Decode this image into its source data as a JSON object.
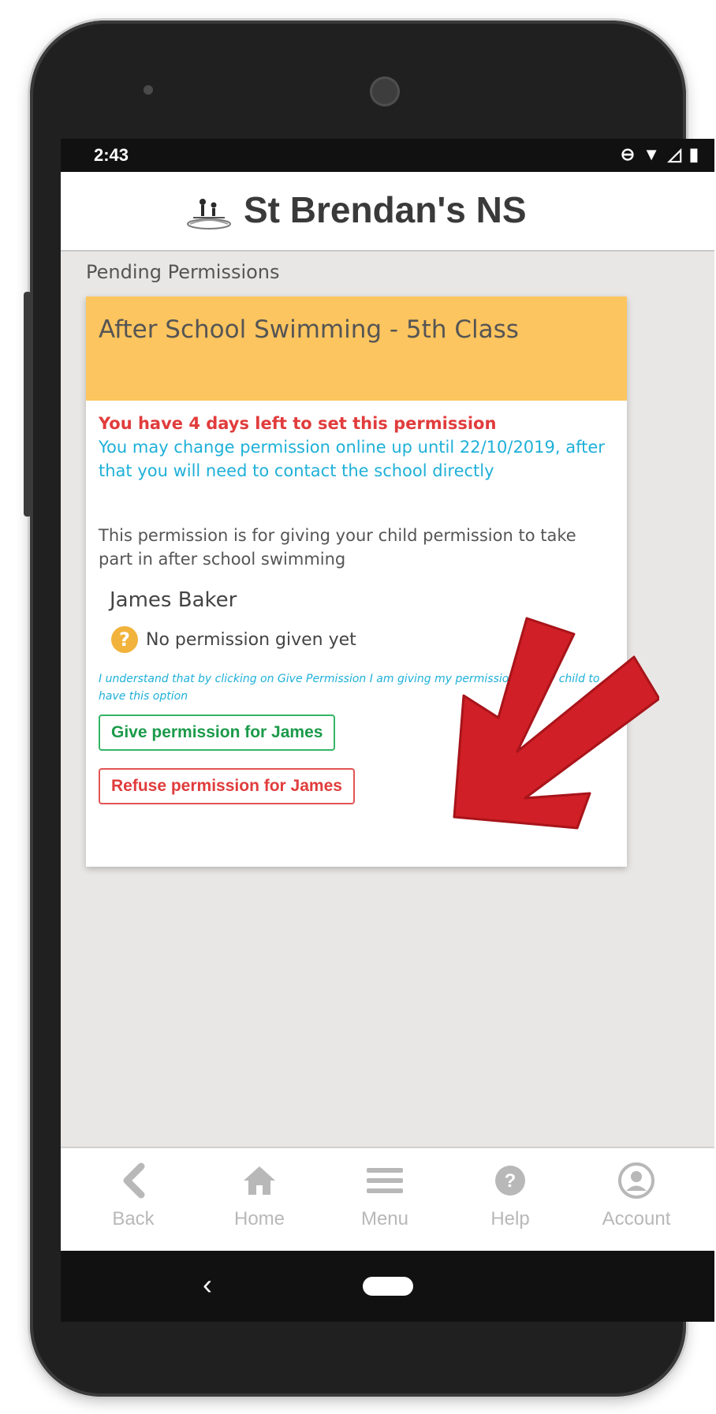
{
  "status_bar": {
    "time": "2:43"
  },
  "header": {
    "title": "St Brendan's NS"
  },
  "section": {
    "title": "Pending Permissions"
  },
  "permission": {
    "title": "After School Swimming - 5th Class",
    "days_left_text": "You have 4 days left to set this permission",
    "change_info": "You may change permission online up until 22/10/2019, after that you will need to contact the school directly",
    "description": "This permission is for giving your child permission to take part in after school swimming",
    "child_name": "James Baker",
    "status_text": "No permission given yet",
    "disclaimer": "I understand that by clicking on Give Permission I am giving my permission for my child to have this option",
    "give_label": "Give permission for James",
    "refuse_label": "Refuse permission for James"
  },
  "bottom_nav": {
    "items": [
      {
        "label": "Back",
        "icon": "chevron-left-icon"
      },
      {
        "label": "Home",
        "icon": "home-icon"
      },
      {
        "label": "Menu",
        "icon": "menu-icon"
      },
      {
        "label": "Help",
        "icon": "help-icon"
      },
      {
        "label": "Account",
        "icon": "account-icon"
      }
    ]
  },
  "colors": {
    "card_header": "#fdc55f",
    "warning": "#e13c3c",
    "info": "#1eb0d8",
    "give": "#1b9a4a",
    "refuse": "#e13c3c",
    "annotation_arrow": "#d01f26"
  }
}
